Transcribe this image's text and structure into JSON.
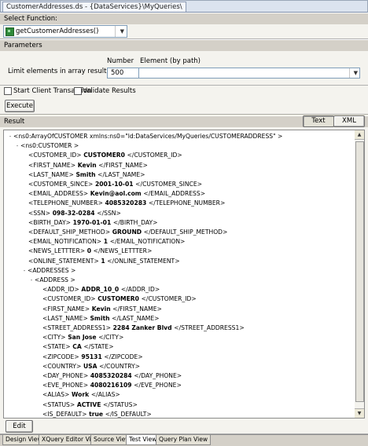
{
  "window": {
    "title": "CustomerAddresses.ds - {DataServices}\\MyQueries\\"
  },
  "select_function": {
    "header": "Select Function:",
    "value": "getCustomerAddresses()"
  },
  "parameters": {
    "header": "Parameters",
    "limit_label": "Limit elements in array results to:",
    "number_label": "Number",
    "number_value": "500",
    "element_label": "Element (by path)",
    "element_value": ""
  },
  "options": {
    "start_client_transaction": "Start Client Transaction",
    "validate_results": "Validate Results"
  },
  "buttons": {
    "execute": "Execute",
    "text": "Text",
    "xml": "XML",
    "edit": "Edit"
  },
  "result": {
    "header": "Result",
    "rows": [
      {
        "pre": "<ns0:ArrayOfCUSTOMER xmlns:ns0=\"ld:DataServices/MyQueries/CUSTOMERADDRESS\" >",
        "val": "",
        "post": ""
      },
      {
        "pre": "<ns0:CUSTOMER >",
        "val": "",
        "post": ""
      },
      {
        "pre": "<CUSTOMER_ID>",
        "val": "CUSTOMER0",
        "post": "</CUSTOMER_ID>"
      },
      {
        "pre": "<FIRST_NAME>",
        "val": "Kevin",
        "post": "</FIRST_NAME>"
      },
      {
        "pre": "<LAST_NAME>",
        "val": "Smith",
        "post": "</LAST_NAME>"
      },
      {
        "pre": "<CUSTOMER_SINCE>",
        "val": "2001-10-01",
        "post": "</CUSTOMER_SINCE>"
      },
      {
        "pre": "<EMAIL_ADDRESS>",
        "val": "Kevin@aol.com",
        "post": "</EMAIL_ADDRESS>"
      },
      {
        "pre": "<TELEPHONE_NUMBER>",
        "val": "4085320283",
        "post": "</TELEPHONE_NUMBER>"
      },
      {
        "pre": "<SSN>",
        "val": "098-32-0284",
        "post": "</SSN>"
      },
      {
        "pre": "<BIRTH_DAY>",
        "val": "1970-01-01",
        "post": "</BIRTH_DAY>"
      },
      {
        "pre": "<DEFAULT_SHIP_METHOD>",
        "val": "GROUND",
        "post": "</DEFAULT_SHIP_METHOD>"
      },
      {
        "pre": "<EMAIL_NOTIFICATION>",
        "val": "1",
        "post": "</EMAIL_NOTIFICATION>"
      },
      {
        "pre": "<NEWS_LETTTER>",
        "val": "0",
        "post": "</NEWS_LETTTER>"
      },
      {
        "pre": "<ONLINE_STATEMENT>",
        "val": "1",
        "post": "</ONLINE_STATEMENT>"
      },
      {
        "pre": "<ADDRESSES >",
        "val": "",
        "post": ""
      },
      {
        "pre": "<ADDRESS >",
        "val": "",
        "post": ""
      },
      {
        "pre": "<ADDR_ID>",
        "val": "ADDR_10_0",
        "post": "</ADDR_ID>"
      },
      {
        "pre": "<CUSTOMER_ID>",
        "val": "CUSTOMER0",
        "post": "</CUSTOMER_ID>"
      },
      {
        "pre": "<FIRST_NAME>",
        "val": "Kevin",
        "post": "</FIRST_NAME>"
      },
      {
        "pre": "<LAST_NAME>",
        "val": "Smith",
        "post": "</LAST_NAME>"
      },
      {
        "pre": "<STREET_ADDRESS1>",
        "val": "2284 Zanker Blvd",
        "post": "</STREET_ADDRESS1>"
      },
      {
        "pre": "<CITY>",
        "val": "San Jose",
        "post": "</CITY>"
      },
      {
        "pre": "<STATE>",
        "val": "CA",
        "post": "</STATE>"
      },
      {
        "pre": "<ZIPCODE>",
        "val": "95131",
        "post": "</ZIPCODE>"
      },
      {
        "pre": "<COUNTRY>",
        "val": "USA",
        "post": "</COUNTRY>"
      },
      {
        "pre": "<DAY_PHONE>",
        "val": "4085320284",
        "post": "</DAY_PHONE>"
      },
      {
        "pre": "<EVE_PHONE>",
        "val": "4080216109",
        "post": "</EVE_PHONE>"
      },
      {
        "pre": "<ALIAS>",
        "val": "Work",
        "post": "</ALIAS>"
      },
      {
        "pre": "<STATUS>",
        "val": "ACTIVE",
        "post": "</STATUS>"
      },
      {
        "pre": "<IS_DEFAULT>",
        "val": "true",
        "post": "</IS_DEFAULT>"
      }
    ]
  },
  "tabs": [
    {
      "label": "Design View",
      "active": false
    },
    {
      "label": "XQuery Editor View",
      "active": false
    },
    {
      "label": "Source View",
      "active": false
    },
    {
      "label": "Test View",
      "active": true
    },
    {
      "label": "Query Plan View",
      "active": false
    }
  ]
}
